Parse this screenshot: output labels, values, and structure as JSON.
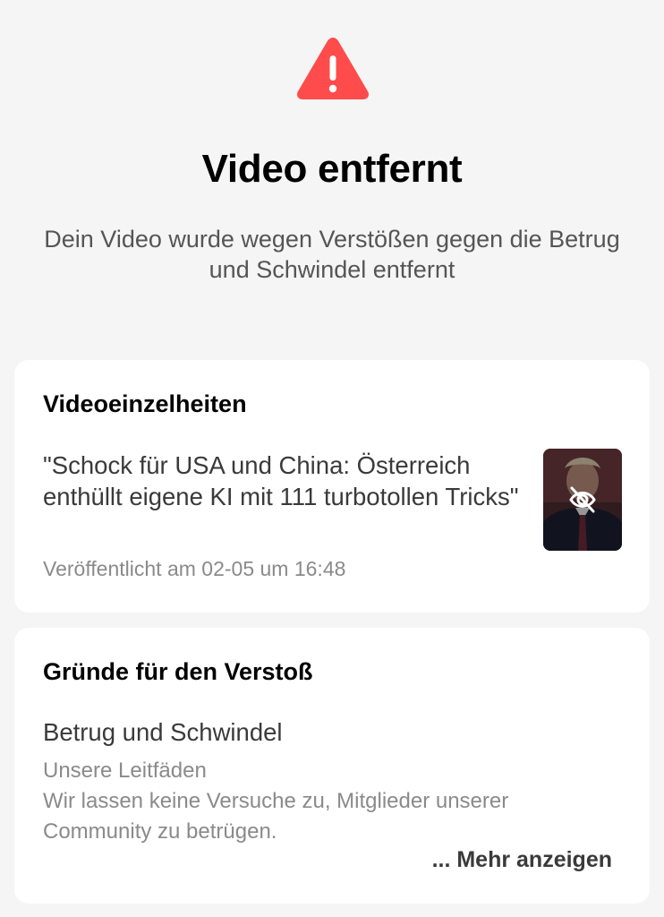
{
  "header": {
    "icon": "warning-triangle-icon",
    "title": "Video entfernt",
    "subtitle": "Dein Video wurde wegen Verstößen gegen die Betrug und Schwindel entfernt"
  },
  "video_details": {
    "heading": "Videoeinzelheiten",
    "video_title": "\"Schock für USA und China: Österreich enthüllt eigene KI mit 111 turbotollen Tricks\"",
    "published": "Veröffentlicht am 02-05 um 16:48",
    "thumbnail_icon": "eye-off-icon"
  },
  "violation": {
    "heading": "Gründe für den Verstoß",
    "reason": "Betrug und Schwindel",
    "guide_label": "Unsere Leitfäden",
    "guide_text": "Wir lassen keine Versuche zu, Mitglieder unserer Community zu betrügen.",
    "more_label": "... Mehr anzeigen"
  },
  "colors": {
    "background": "#f5f5f5",
    "card": "#ffffff",
    "warning": "#fe4c4c"
  }
}
